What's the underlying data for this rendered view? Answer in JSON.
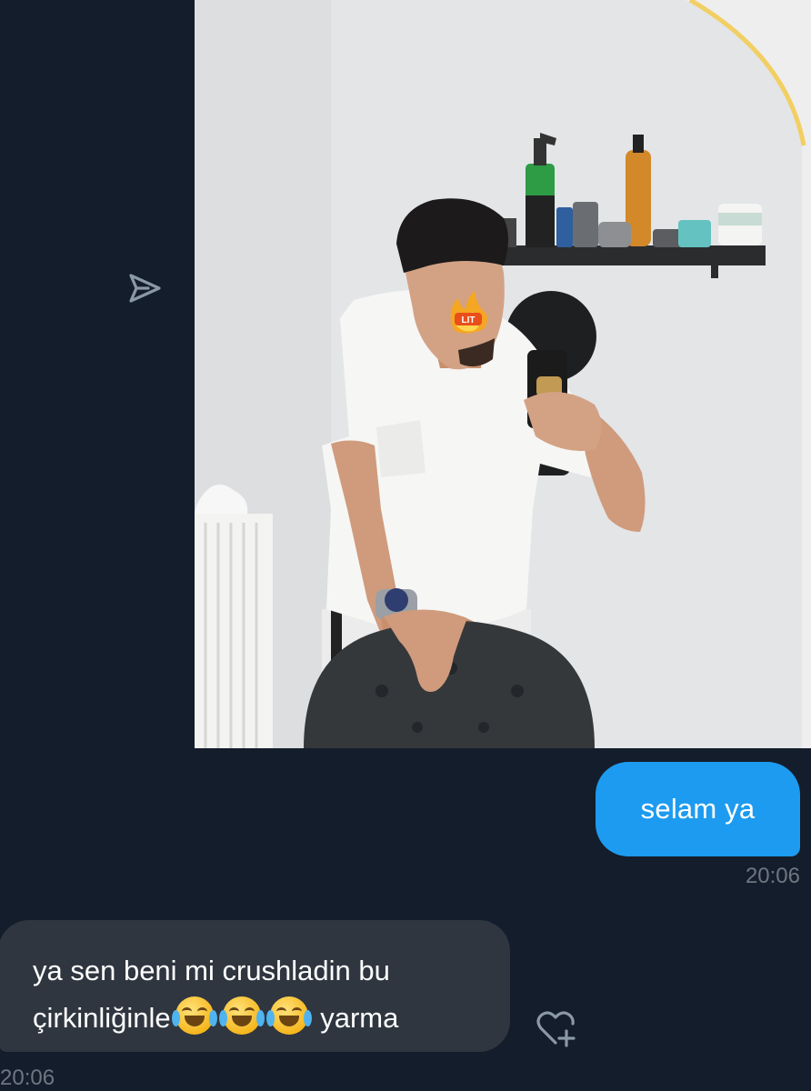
{
  "conversation": {
    "messages": [
      {
        "direction": "outgoing",
        "type": "image",
        "image_alt": "Mirror selfie of a young man in a white t-shirt leaning on a black chair in a barber shop, face partly covered by a LIT fire sticker"
      },
      {
        "direction": "outgoing",
        "type": "text",
        "text": "selam ya",
        "time": "20:06"
      },
      {
        "direction": "incoming",
        "type": "text",
        "line1": "ya sen beni mi crushladin bu",
        "line2_prefix": "çirkinliğinle",
        "line2_suffix": "yarma",
        "emojis": [
          "face-with-tears-of-joy",
          "face-with-tears-of-joy",
          "face-with-tears-of-joy"
        ],
        "time": "20:06"
      }
    ]
  },
  "icons": {
    "share": "send-arrow-icon",
    "react": "heart-plus-icon",
    "sticker": "lit-fire-sticker"
  },
  "colors": {
    "background": "#141d2b",
    "outgoing_bubble": "#1d9bf0",
    "incoming_bubble": "#2f3640",
    "timestamp": "#6e7681",
    "text": "#ffffff"
  }
}
